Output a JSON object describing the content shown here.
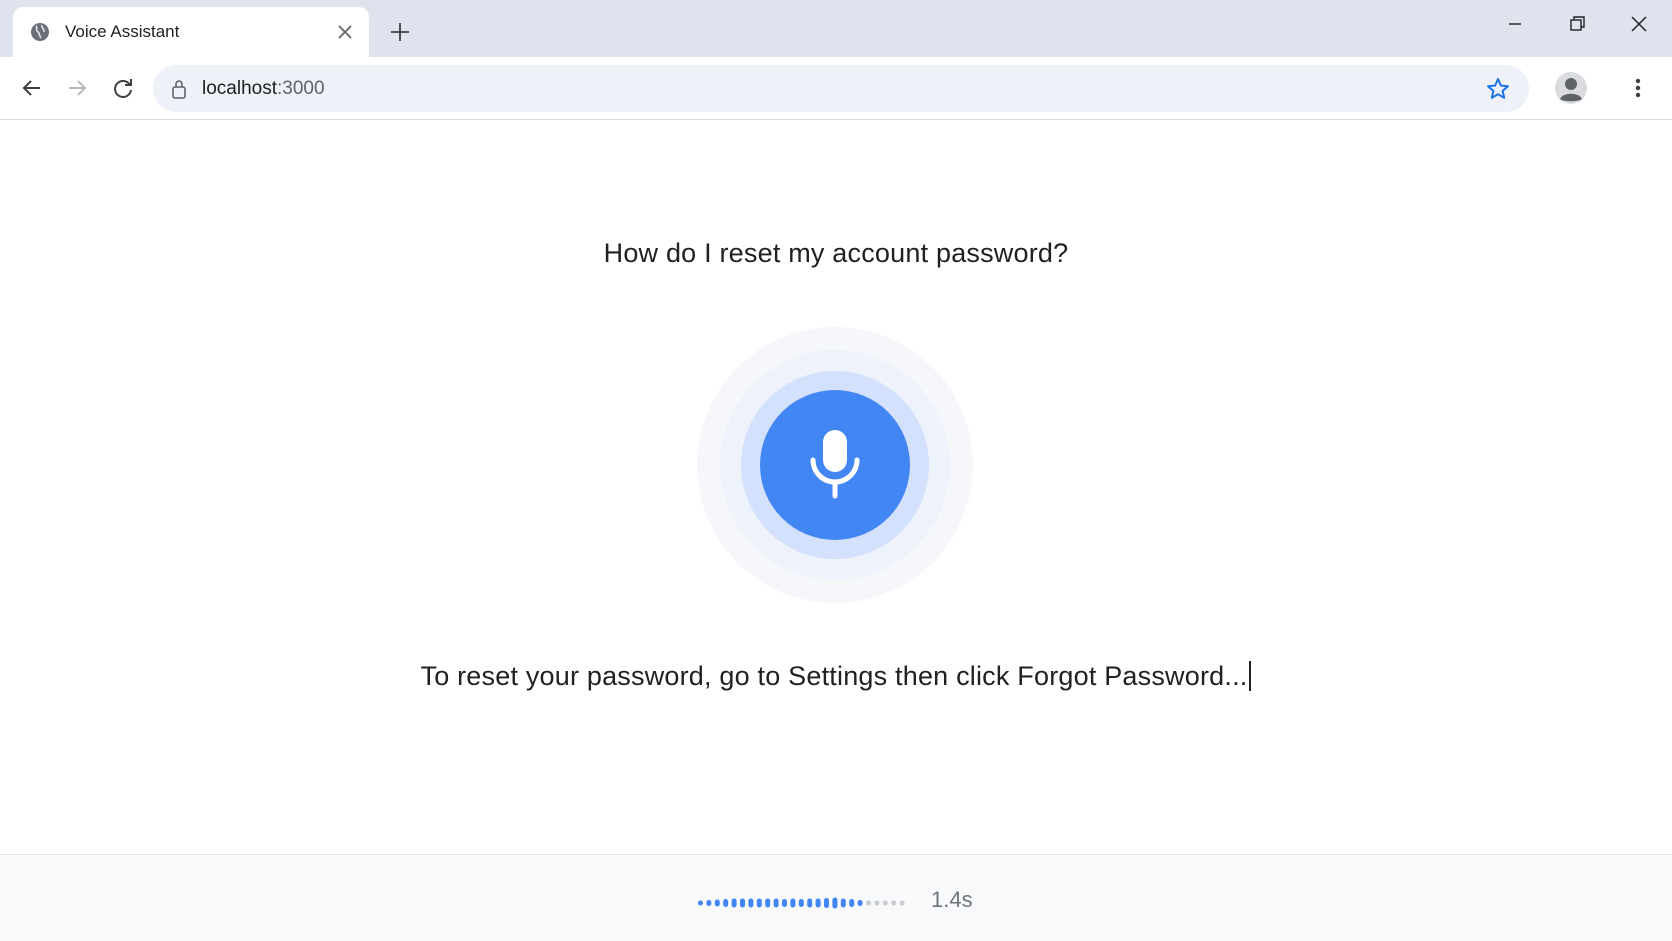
{
  "browser": {
    "tab_title": "Voice Assistant",
    "url_host": "localhost",
    "url_port": ":3000",
    "icons": {
      "favicon": "globe-icon",
      "close": "close-icon",
      "new_tab": "plus-icon",
      "back": "arrow-left-icon",
      "forward": "arrow-right-icon",
      "reload": "reload-icon",
      "site_info": "lock-icon",
      "bookmark": "star-icon",
      "profile": "avatar-icon",
      "menu": "kebab-menu-icon",
      "minimize": "minimize-icon",
      "maximize": "restore-icon",
      "window_close": "window-close-icon"
    }
  },
  "assistant": {
    "question": "How do I reset my account password?",
    "answer": "To reset your password, go to Settings then click Forgot Password...",
    "mic_icon": "microphone-icon",
    "accent_color": "#4286f4"
  },
  "status": {
    "elapsed": "1.4s",
    "waveform_active_color": "#4286f4",
    "waveform_idle_color": "#c8cbd0"
  }
}
